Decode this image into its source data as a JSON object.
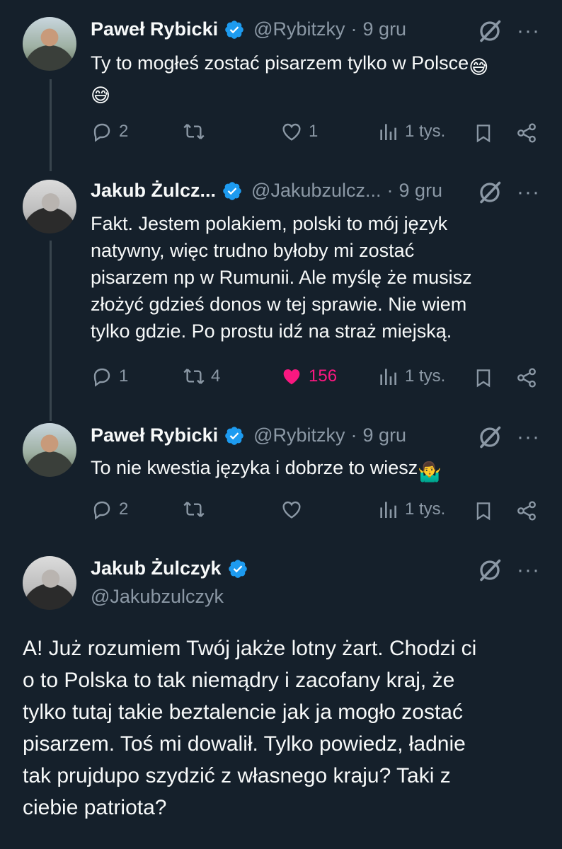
{
  "tweets": [
    {
      "author": "Paweł Rybicki",
      "handle": "@Rybitzky",
      "time": "9 gru",
      "separator": "·",
      "text": "Ty to mogłeś zostać pisarzem tylko w Polsce",
      "emoji": "😅",
      "replies": "2",
      "retweets": "",
      "likes": "1",
      "views": "1 tys."
    },
    {
      "author": "Jakub Żulcz...",
      "handle": "@Jakubzulcz...",
      "time": "9 gru",
      "separator": "·",
      "text_lines": [
        "Fakt. Jestem polakiem, polski to mój język",
        "natywny, więc trudno byłoby mi zostać",
        "pisarzem np w Rumunii. Ale myślę że musisz",
        "złożyć gdzieś donos w tej sprawie. Nie wiem",
        "tylko gdzie. Po prostu idź na straż miejską."
      ],
      "replies": "1",
      "retweets": "4",
      "likes": "156",
      "views": "1 tys."
    },
    {
      "author": "Paweł Rybicki",
      "handle": "@Rybitzky",
      "time": "9 gru",
      "separator": "·",
      "text": "To nie kwestia języka i dobrze to wiesz",
      "emoji": "🤷‍♂️",
      "replies": "2",
      "retweets": "",
      "likes": "",
      "views": "1 tys."
    },
    {
      "author": "Jakub Żulczyk",
      "handle": "@Jakubzulczyk",
      "text_lines": [
        "A! Już rozumiem Twój jakże lotny żart. Chodzi ci",
        "o to Polska to tak niemądry i zacofany kraj, że",
        "tylko tutaj takie beztalencie jak ja mogło zostać",
        "pisarzem. Toś mi dowalił. Tylko powiedz, ładnie",
        "tak prujdupo szydzić z własnego kraju? Taki z",
        "ciebie patriota?"
      ]
    }
  ],
  "colors": {
    "background": "#15202b",
    "text": "#f7f9f9",
    "muted": "#8b98a5",
    "verified": "#1d9bf0",
    "like": "#f91880"
  },
  "icons": [
    "verified-badge-icon",
    "grok-icon",
    "more-icon",
    "reply-icon",
    "retweet-icon",
    "like-icon",
    "views-icon",
    "bookmark-icon",
    "share-icon"
  ]
}
